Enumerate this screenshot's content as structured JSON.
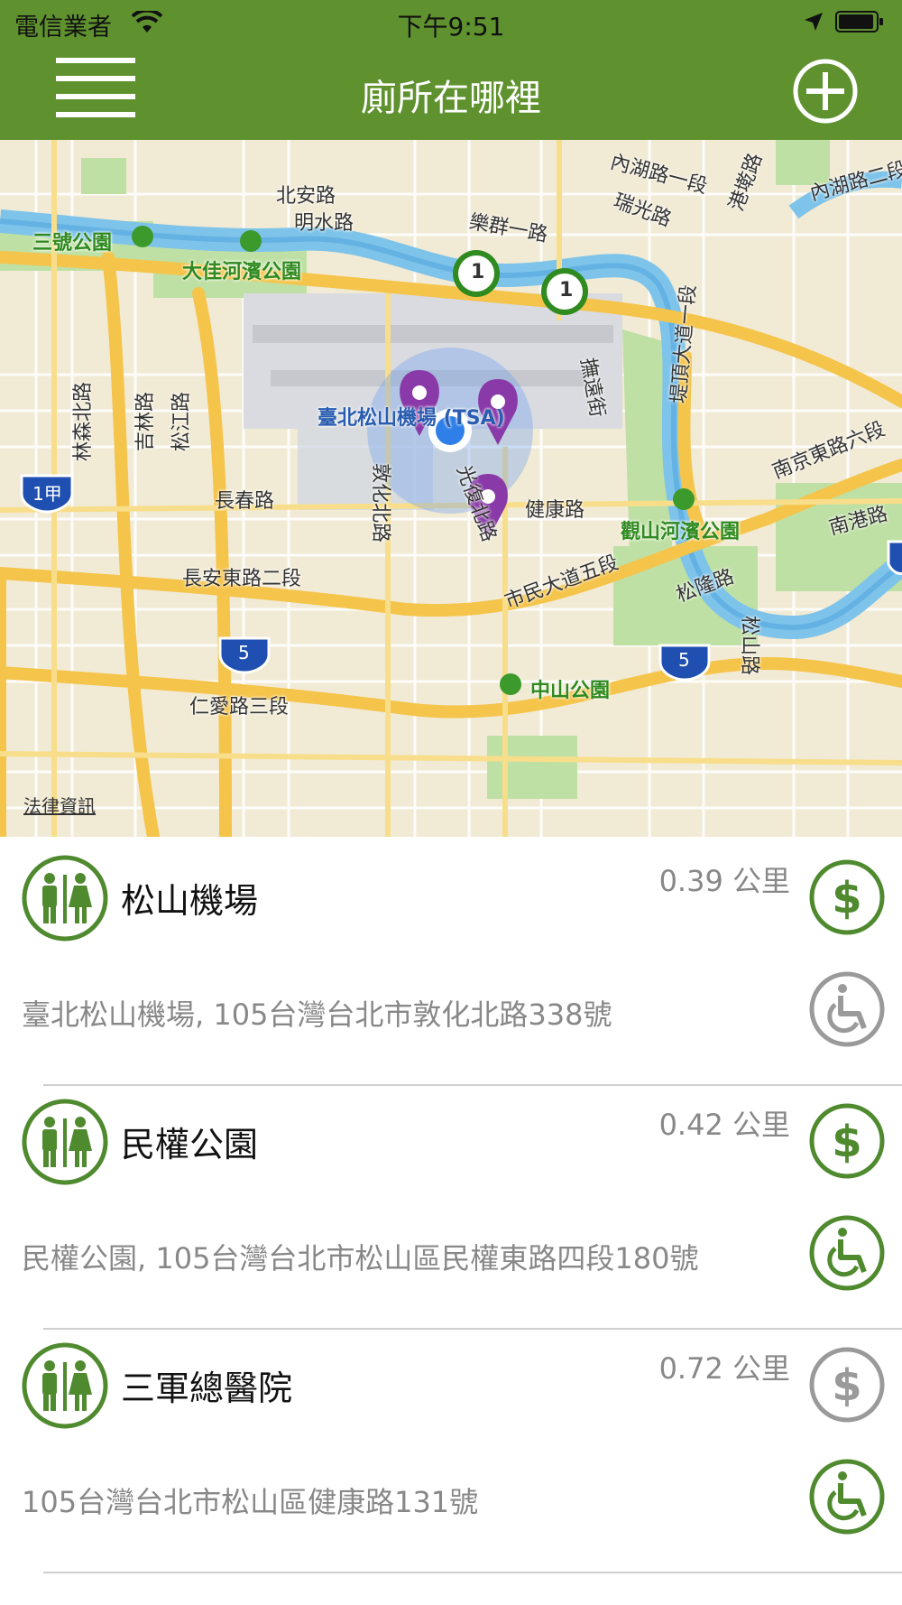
{
  "status_bar": {
    "carrier": "電信業者",
    "time": "下午9:51"
  },
  "nav": {
    "title": "廁所在哪裡"
  },
  "map": {
    "labels": {
      "beian": "北安路",
      "mingshui": "明水路",
      "lequn": "樂群一路",
      "neihu1": "內湖路一段",
      "ruiguang": "瑞光路",
      "gangqian": "港墘路",
      "neihu2": "內湖路二段",
      "sanhao": "三號公園",
      "dajia": "大佳河濱公園",
      "linsen": "林森北路",
      "jilin": "吉林路",
      "songjiang": "松江路",
      "dunhua": "敦化北路",
      "airport": "臺北松山機場 (TSA)",
      "fuyuan": "撫遠街",
      "dike": "堤頂大道一段",
      "nanjing6": "南京東路六段",
      "changchun": "長春路",
      "guangfu": "光復北路",
      "jiankang": "健康路",
      "guanshan": "觀山河濱公園",
      "nangang": "南港路",
      "changan": "長安東路二段",
      "civic": "市民大道五段",
      "songlong": "松隆路",
      "songshan": "松山路",
      "zhongshan": "中山公園",
      "renai": "仁愛路三段",
      "shield_1jia": "1甲",
      "shield_5a": "5",
      "shield_5b": "5",
      "shield_1a": "1",
      "shield_1b": "1"
    },
    "legal": "法律資訊"
  },
  "toilets": [
    {
      "name": "松山機場",
      "distance": "0.39 公里",
      "address": "臺北松山機場, 105台灣台北市敦化北路338號",
      "fee_icon": "dollar-icon",
      "fee_color": "#4f8a2f",
      "accessible_icon": "wheelchair-icon",
      "accessible_color": "#9a9a9a"
    },
    {
      "name": "民權公園",
      "distance": "0.42 公里",
      "address": "民權公園, 105台灣台北市松山區民權東路四段180號",
      "fee_icon": "dollar-icon",
      "fee_color": "#4f8a2f",
      "accessible_icon": "wheelchair-icon",
      "accessible_color": "#4f8a2f"
    },
    {
      "name": "三軍總醫院",
      "distance": "0.72 公里",
      "address": "105台灣台北市松山區健康路131號",
      "fee_icon": "dollar-icon",
      "fee_color": "#9a9a9a",
      "accessible_icon": "wheelchair-icon",
      "accessible_color": "#4f8a2f"
    }
  ],
  "colors": {
    "nav_bar": "#5f922f",
    "accent_green": "#4f8a2f",
    "pin_purple": "#8a3aa8",
    "user_dot": "#2f7fe8"
  }
}
